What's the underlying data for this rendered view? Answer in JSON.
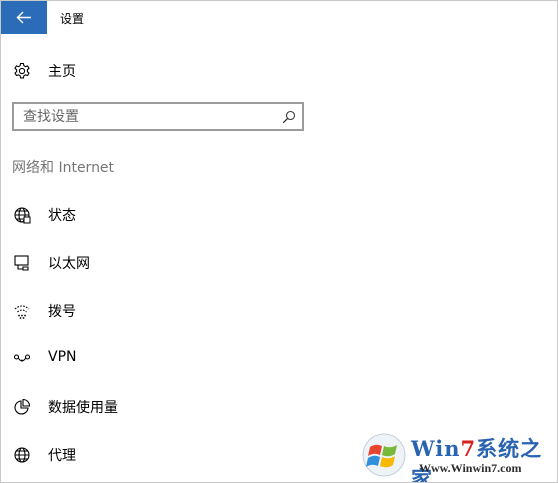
{
  "window": {
    "title": "设置",
    "accent_color": "#2b6cb8",
    "back_icon": "arrow-left-icon"
  },
  "home": {
    "label": "主页",
    "icon": "gear-icon"
  },
  "search": {
    "placeholder": "查找设置",
    "value": "",
    "icon": "search-icon"
  },
  "section": {
    "title": "网络和 Internet"
  },
  "nav": {
    "items": [
      {
        "label": "状态",
        "icon": "globe-status-icon"
      },
      {
        "label": "以太网",
        "icon": "ethernet-icon"
      },
      {
        "label": "拨号",
        "icon": "dialup-icon"
      },
      {
        "label": "VPN",
        "icon": "vpn-icon"
      },
      {
        "label": "数据使用量",
        "icon": "pie-chart-icon"
      },
      {
        "label": "代理",
        "icon": "globe-icon"
      }
    ]
  },
  "watermark": {
    "brand_prefix": "Win",
    "brand_seven": "7",
    "brand_suffix": "系统之家",
    "url": "Www.Winwin7.com"
  }
}
